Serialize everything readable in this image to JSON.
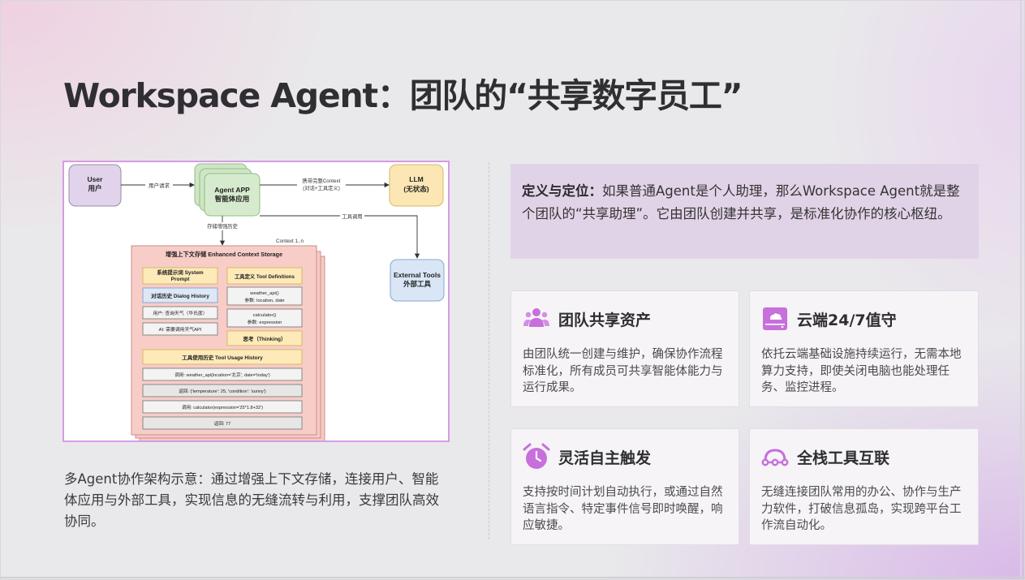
{
  "title": "Workspace Agent：团队的“共享数字员工”",
  "colors": {
    "accent": "#c76fdc",
    "accent_light": "#e1d3e7",
    "card_bg": "#f6f4f7"
  },
  "main": {
    "image_panel": {
      "diagram": {
        "user": {
          "line1": "User",
          "line2": "用户"
        },
        "agent_app": {
          "line1": "Agent APP",
          "line2": "智能体应用"
        },
        "llm": {
          "line1": "LLM",
          "line2": "(无状态)"
        },
        "external_tools": {
          "line1": "External Tools",
          "line2": "外部工具"
        },
        "arrow_user_request": "用户请求",
        "arrow_context_line1": "携带完整Context",
        "arrow_context_line2": "(对话+工具定义)",
        "arrow_tool_call": "工具调用",
        "arrow_store_history": "存储增强历史",
        "context_label": "Context 1..n",
        "context_box": {
          "title": "增强上下文存储 Enhanced Context Storage",
          "system_prompt_line1": "系统提示词 System",
          "system_prompt_line2": "Prompt",
          "tool_defs": "工具定义 Tool Definitions",
          "dialog_history": "对话历史 Dialog History",
          "user_msg": "用户: 查询天气（华氏度）",
          "ai_msg": "AI: 需要调用天气API",
          "weather_api_line1": "weather_api()",
          "weather_api_line2": "参数: location, date",
          "calculator_line1": "calculator()",
          "calculator_line2": "参数: expression",
          "thinking": "思考（Thinking）",
          "usage_history": "工具使用历史 Tool Usage History",
          "usage_rows": [
            "调用: weather_api(location='北京', date='today')",
            "返回: {'temperature': 25, 'condition': 'sunny'}",
            "调用: calculator(expression='25*1.8+32')",
            "返回: 77"
          ]
        }
      }
    },
    "caption": "多Agent协作架构示意：通过增强上下文存储，连接用户、智能体应用与外部工具，实现信息的无缝流转与利用，支撑团队高效协同。",
    "definition": {
      "label": "定义与定位：",
      "text": "如果普通Agent是个人助理，那么Workspace Agent就是整个团队的“共享助理”。它由团队创建并共享，是标准化协作的核心枢纽。"
    },
    "cards": [
      {
        "icon": "team-icon",
        "title": "团队共享资产",
        "text": "由团队统一创建与维护，确保协作流程标准化，所有成员可共享智能体能力与运行成果。"
      },
      {
        "icon": "cloud-server-icon",
        "title": "云端24/7值守",
        "text": "依托云端基础设施持续运行，无需本地算力支持，即使关闭电脑也能处理任务、监控进程。"
      },
      {
        "icon": "alarm-clock-icon",
        "title": "灵活自主触发",
        "text": "支持按时间计划自动执行，或通过自然语言指令、特定事件信号即时唤醒，响应敏捷。"
      },
      {
        "icon": "link-icon",
        "title": "全栈工具互联",
        "text": "无缝连接团队常用的办公、协作与生产力软件，打破信息孤岛，实现跨平台工作流自动化。"
      }
    ]
  }
}
